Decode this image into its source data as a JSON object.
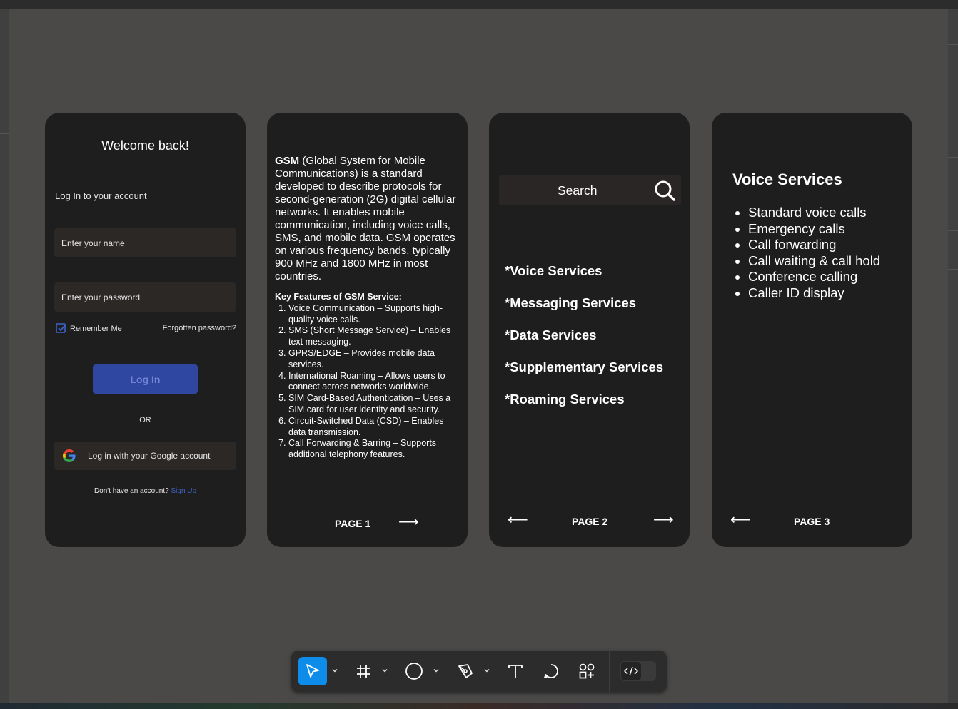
{
  "login": {
    "welcome": "Welcome back!",
    "subtitle": "Log In to your account",
    "name_placeholder": "Enter your name",
    "password_placeholder": "Enter your password",
    "remember": "Remember Me",
    "forgot": "Forgotten password?",
    "login_button": "Log In",
    "or": "OR",
    "google": "Log in with your Google account",
    "no_account": "Don't have an account?",
    "signup": "Sign Up"
  },
  "page1": {
    "gsm_bold": "GSM",
    "gsm_text": " (Global System for Mobile Communications) is a standard developed to describe protocols for second-generation (2G) digital cellular networks. It enables mobile communication, including voice calls, SMS, and mobile data. GSM operates on various frequency bands, typically 900 MHz and 1800 MHz in most countries.",
    "features_title": "Key Features of GSM Service:",
    "features": [
      "Voice Communication – Supports high-quality voice calls.",
      "SMS (Short Message Service) – Enables text messaging.",
      "GPRS/EDGE – Provides mobile data services.",
      "International Roaming – Allows users to connect across networks worldwide.",
      "SIM Card-Based Authentication – Uses a SIM card for user identity and security.",
      "Circuit-Switched Data (CSD) – Enables data transmission.",
      "Call Forwarding & Barring – Supports additional telephony features."
    ],
    "page_label": "PAGE 1"
  },
  "page2": {
    "search": "Search",
    "services": [
      "*Voice Services",
      "*Messaging Services",
      "*Data Services",
      "*Supplementary Services",
      "*Roaming Services"
    ],
    "page_label": "PAGE 2"
  },
  "page3": {
    "title": "Voice Services",
    "items": [
      "Standard voice calls",
      "Emergency calls",
      "Call forwarding",
      "Call waiting & call hold",
      "Conference calling",
      "Caller ID display"
    ],
    "page_label": "PAGE 3"
  },
  "arrows": {
    "right": "⟶",
    "left": "⟵"
  },
  "toolbar": {
    "tools": [
      "move-tool",
      "frame-tool",
      "shape-tool",
      "pen-tool",
      "text-tool",
      "comment-tool",
      "actions-tool",
      "dev-mode-toggle"
    ]
  },
  "colors": {
    "canvas": "#4a4948",
    "card": "#1e1e1e",
    "accent_blue": "#2f47a0",
    "selected_tool": "#0d8ce9"
  }
}
